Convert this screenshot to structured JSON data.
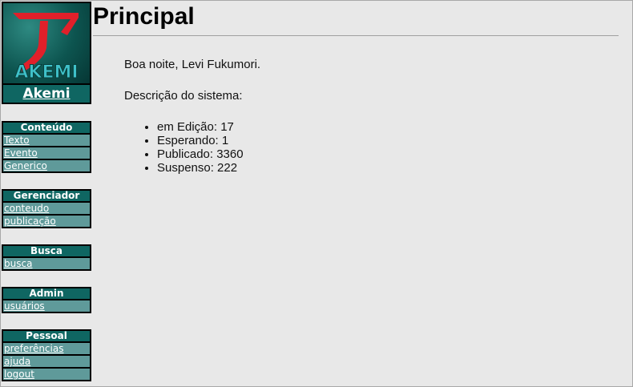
{
  "brand": {
    "logo_text": "AKEMI",
    "logo_glyph": "ア",
    "name": "Akemi"
  },
  "sidebar": {
    "groups": [
      {
        "title": "Conteúdo",
        "items": [
          "Texto",
          "Evento",
          "Generico"
        ]
      },
      {
        "title": "Gerenciador",
        "items": [
          "conteudo",
          "publicação"
        ]
      },
      {
        "title": "Busca",
        "items": [
          "busca"
        ]
      },
      {
        "title": "Admin",
        "items": [
          "usuários"
        ]
      },
      {
        "title": "Pessoal",
        "items": [
          "preferências",
          "ajuda",
          "logout"
        ]
      }
    ]
  },
  "page": {
    "title": "Principal",
    "greeting": "Boa noite, Levi Fukumori.",
    "description": "Descrição do sistema:",
    "stats": [
      "em Edição: 17",
      "Esperando: 1",
      "Publicado: 3360",
      "Suspenso: 222"
    ]
  },
  "colors": {
    "background": "#e8e8e8",
    "menu_header": "#0f6662",
    "menu_item": "#5f9a9a",
    "logo_red": "#e0202a"
  }
}
